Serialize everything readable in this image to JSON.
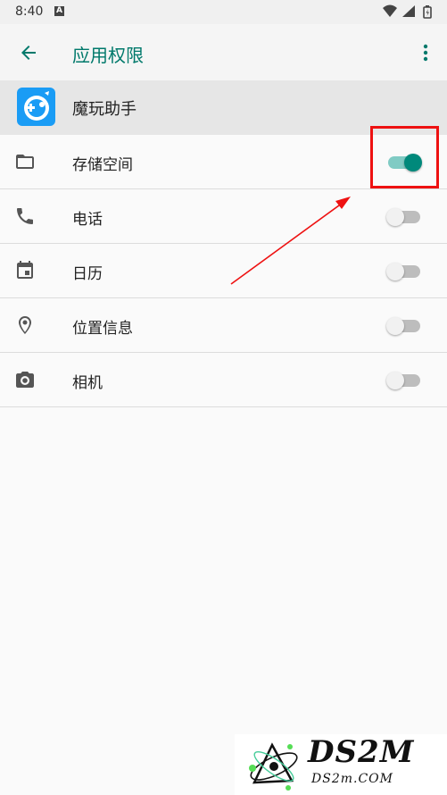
{
  "status_bar": {
    "time": "8:40",
    "badge": "A"
  },
  "app_bar": {
    "title": "应用权限"
  },
  "app": {
    "name": "魔玩助手"
  },
  "permissions": [
    {
      "label": "存储空间",
      "icon": "folder-icon",
      "enabled": true
    },
    {
      "label": "电话",
      "icon": "phone-icon",
      "enabled": false
    },
    {
      "label": "日历",
      "icon": "calendar-icon",
      "enabled": false
    },
    {
      "label": "位置信息",
      "icon": "location-icon",
      "enabled": false
    },
    {
      "label": "相机",
      "icon": "camera-icon",
      "enabled": false
    }
  ],
  "colors": {
    "accent": "#00796b",
    "highlight": "#ee1111"
  },
  "watermark": {
    "brand": "DS2M",
    "domain": "DS2m.COM"
  }
}
